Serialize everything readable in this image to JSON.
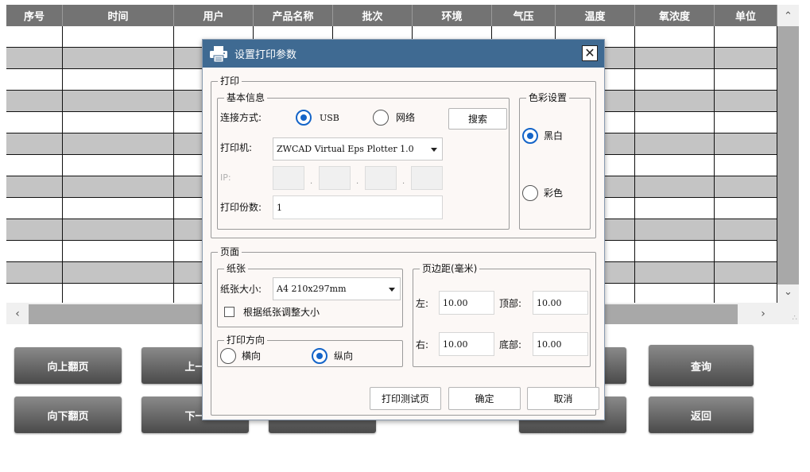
{
  "table": {
    "columns": [
      "序号",
      "时间",
      "用户",
      "产品名称",
      "批次",
      "环境",
      "气压",
      "温度",
      "氧浓度",
      "单位"
    ],
    "row_count": 13
  },
  "scrollbars": {
    "up": "⌃",
    "down": "⌄",
    "left": "‹",
    "right": "›",
    "grip": "∴"
  },
  "buttons": {
    "page_up": "向上翻页",
    "page_down": "向下翻页",
    "prev": "上一",
    "next": "下一",
    "query": "查询",
    "back": "返回"
  },
  "dialog": {
    "title": "设置打印参数",
    "close": "✕",
    "icon": "printer-icon",
    "print_group": {
      "legend": "打印",
      "basic_info": {
        "legend": "基本信息",
        "connection_label": "连接方式:",
        "usb_label": "USB",
        "network_label": "网络",
        "connection_selected": "USB",
        "search_button": "搜索",
        "printer_label": "打印机:",
        "printer_value": "ZWCAD Virtual Eps Plotter 1.0",
        "ip_label": "IP:",
        "ip_sep": ".",
        "copies_label": "打印份数:",
        "copies_value": "1"
      },
      "color": {
        "legend": "色彩设置",
        "bw_label": "黑白",
        "color_label": "彩色",
        "selected": "黑白"
      }
    },
    "page_group": {
      "legend": "页面",
      "paper": {
        "legend": "纸张",
        "size_label": "纸张大小:",
        "size_value": "A4 210x297mm",
        "fit_label": "根据纸张调整大小",
        "fit_checked": false
      },
      "orientation": {
        "legend": "打印方向",
        "landscape": "横向",
        "portrait": "纵向",
        "selected": "纵向"
      },
      "margins": {
        "legend": "页边距(毫米)",
        "left_label": "左:",
        "left_value": "10.00",
        "top_label": "顶部:",
        "top_value": "10.00",
        "right_label": "右:",
        "right_value": "10.00",
        "bottom_label": "底部:",
        "bottom_value": "10.00"
      }
    },
    "footer": {
      "test_page": "打印测试页",
      "ok": "确定",
      "cancel": "取消"
    }
  },
  "colors": {
    "title_bar": "#3f6a92",
    "header": "#737373",
    "alt_row": "#c4c4c4",
    "radio_accent": "#1464c8"
  }
}
